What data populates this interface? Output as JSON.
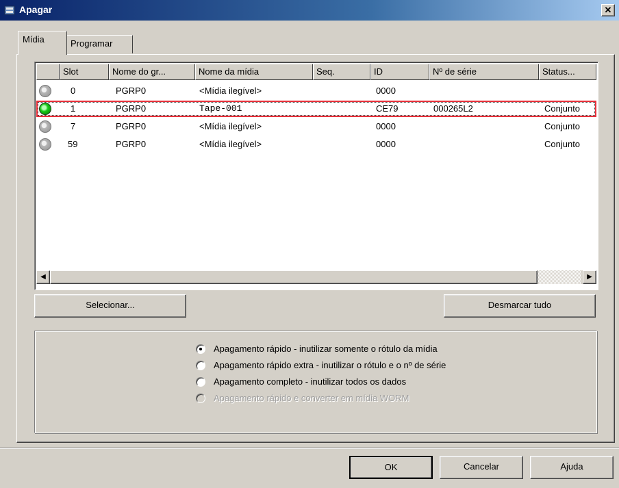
{
  "window": {
    "title": "Apagar",
    "close_label": "✕"
  },
  "tabs": [
    {
      "label": "Mídia",
      "active": true
    },
    {
      "label": "Programar",
      "active": false
    }
  ],
  "columns": [
    "",
    "Slot",
    "Nome do gr...",
    "Nome da mídia",
    "Seq.",
    "ID",
    "Nº de série",
    "Status..."
  ],
  "rows": [
    {
      "status": "gray",
      "slot": "0",
      "group": "PGRP0",
      "media": "<Mídia ilegível>",
      "seq": "",
      "id": "0000",
      "serial": "",
      "state": ""
    },
    {
      "status": "green",
      "slot": "1",
      "group": "PGRP0",
      "media": "Tape-001",
      "seq": "",
      "id": "CE79",
      "serial": "000265L2",
      "state": "Conjunto",
      "selected": true
    },
    {
      "status": "gray",
      "slot": "7",
      "group": "PGRP0",
      "media": "<Mídia ilegível>",
      "seq": "",
      "id": "0000",
      "serial": "",
      "state": "Conjunto"
    },
    {
      "status": "gray",
      "slot": "59",
      "group": "PGRP0",
      "media": "<Mídia ilegível>",
      "seq": "",
      "id": "0000",
      "serial": "",
      "state": "Conjunto"
    }
  ],
  "buttons": {
    "select": "Selecionar...",
    "deselect_all": "Desmarcar tudo",
    "ok": "OK",
    "cancel": "Cancelar",
    "help": "Ajuda"
  },
  "erase_options": [
    {
      "label": "Apagamento rápido - inutilizar somente o rótulo da mídia",
      "checked": true,
      "disabled": false
    },
    {
      "label": "Apagamento rápido extra - inutilizar o rótulo e o nº de série",
      "checked": false,
      "disabled": false
    },
    {
      "label": "Apagamento completo - inutilizar todos os dados",
      "checked": false,
      "disabled": false
    },
    {
      "label": "Apagamento rápido e converter em mídia WORM",
      "checked": false,
      "disabled": true
    }
  ],
  "colors": {
    "title_start": "#0a246a",
    "title_end": "#a6caf0",
    "face": "#d4d0c8",
    "selection_outline": "#e8303a"
  }
}
